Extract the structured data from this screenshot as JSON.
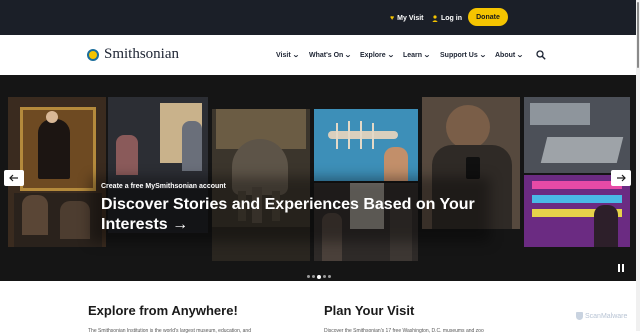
{
  "utility_bar": {
    "my_visit": "My Visit",
    "log_in": "Log in",
    "donate": "Donate"
  },
  "logo": {
    "text": "Smithsonian"
  },
  "nav": [
    {
      "label": "Visit"
    },
    {
      "label": "What's On"
    },
    {
      "label": "Explore"
    },
    {
      "label": "Learn"
    },
    {
      "label": "Support Us"
    },
    {
      "label": "About"
    }
  ],
  "icons": {
    "heart": "heart-icon",
    "user": "user-icon",
    "search": "search-icon",
    "prev": "arrow-left-icon",
    "next": "arrow-right-icon",
    "pause": "pause-icon"
  },
  "hero": {
    "kicker": "Create a free MySmithsonian account",
    "headline": "Discover Stories and Experiences Based on Your Interests →",
    "slide_count": 5,
    "active_slide": 3
  },
  "sections": {
    "explore_title": "Explore from Anywhere!",
    "explore_text": "The Smithsonian Institution is the world's largest museum, education, and",
    "visit_title": "Plan Your Visit",
    "visit_text": "Discover the Smithsonian's 17 free Washington, D.C. museums and zoo"
  },
  "watermark": {
    "text": "ScanMalware"
  },
  "colors": {
    "accent": "#f5c400",
    "utility_bg": "#1b1f28",
    "text_dark": "#1d2433",
    "link_blue": "#1c6e9c"
  }
}
